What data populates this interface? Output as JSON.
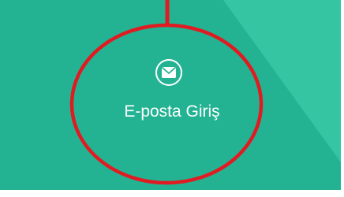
{
  "tile": {
    "background_color": "#23b392",
    "accent_shade_color": "#35c5a3"
  },
  "login_button": {
    "icon": "envelope-icon",
    "label": "E-posta Giriş"
  },
  "annotation": {
    "color": "#e01b22",
    "shape": "ellipse-with-pointer-line"
  }
}
